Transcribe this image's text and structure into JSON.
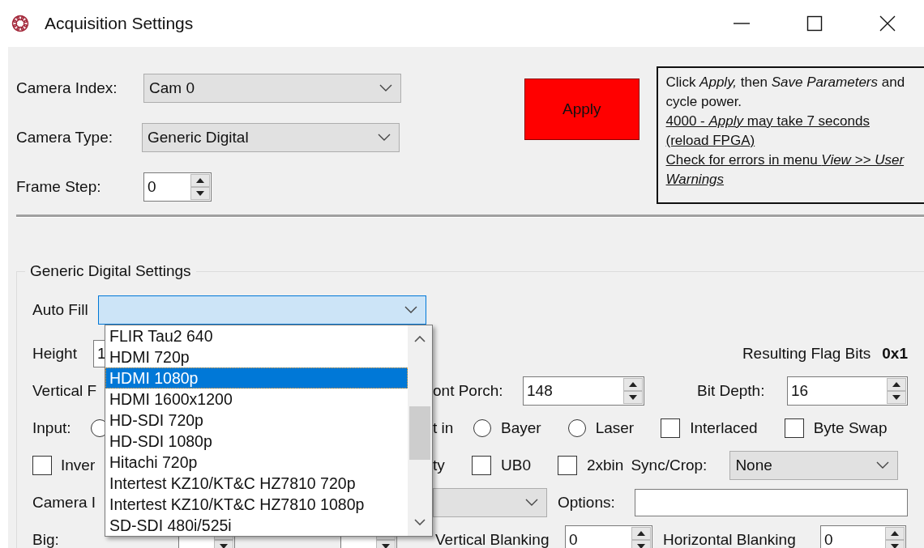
{
  "window": {
    "title": "Acquisition Settings"
  },
  "camera_index": {
    "label": "Camera Index:",
    "value": "Cam 0"
  },
  "camera_type": {
    "label": "Camera Type:",
    "value": "Generic Digital"
  },
  "frame_step": {
    "label": "Frame Step:",
    "value": "0"
  },
  "apply_button": {
    "label": "Apply"
  },
  "note": {
    "text": "Click *Apply,* then *Save Parameters* and cycle power.",
    "links": [
      "4000 - *Apply* may take 7 seconds (reload FPGA)",
      "Check for errors in menu *View >> User Warnings*"
    ]
  },
  "group": {
    "title": "Generic Digital Settings",
    "auto_fill": {
      "label": "Auto Fill",
      "list": [
        {
          "label": "FLIR Tau2 640",
          "selected": false
        },
        {
          "label": "HDMI 720p",
          "selected": false
        },
        {
          "label": "HDMI 1080p",
          "selected": true
        },
        {
          "label": "HDMI 1600x1200",
          "selected": false
        },
        {
          "label": "HD-SDI 720p",
          "selected": false
        },
        {
          "label": "HD-SDI 1080p",
          "selected": false
        },
        {
          "label": "Hitachi 720p",
          "selected": false
        },
        {
          "label": "Intertest KZ10/KT&C HZ7810 720p",
          "selected": false
        },
        {
          "label": "Intertest KZ10/KT&C HZ7810 1080p",
          "selected": false
        },
        {
          "label": "SD-SDI 480i/525i",
          "selected": false
        }
      ]
    },
    "height": {
      "label": "Height",
      "value": "1"
    },
    "flag_bits": {
      "label": "Resulting Flag Bits",
      "value": "0x1"
    },
    "front_porch": {
      "label_start": "Vertical F",
      "label_end": "ont Porch:",
      "value": "148"
    },
    "bit_depth": {
      "label": "Bit Depth:",
      "value": "16"
    },
    "input": {
      "label": "Input:",
      "covered_label_end": "t in",
      "options": [
        {
          "selected": false
        },
        {
          "label": "Bayer",
          "selected": false
        },
        {
          "label": "Laser",
          "selected": false
        }
      ]
    },
    "flags": [
      {
        "label": "Interlaced",
        "checked": false
      },
      {
        "label": "Byte Swap",
        "checked": false
      }
    ],
    "invert": {
      "label": "Inver",
      "checked": false
    },
    "covered_label_end": "ty",
    "bits": [
      {
        "label": "UB0",
        "checked": false
      },
      {
        "label": "2xbin",
        "checked": false
      }
    ],
    "sync_crop": {
      "label": "Sync/Crop:",
      "value": "None"
    },
    "camera_i": {
      "label": "Camera I"
    },
    "options": {
      "label": "Options:"
    },
    "big": {
      "label": "Big:",
      "fields": [
        {
          "label": "Vertical Blanking",
          "value": "0"
        },
        {
          "label": "Horizontal Blanking",
          "value": "0"
        }
      ]
    }
  }
}
